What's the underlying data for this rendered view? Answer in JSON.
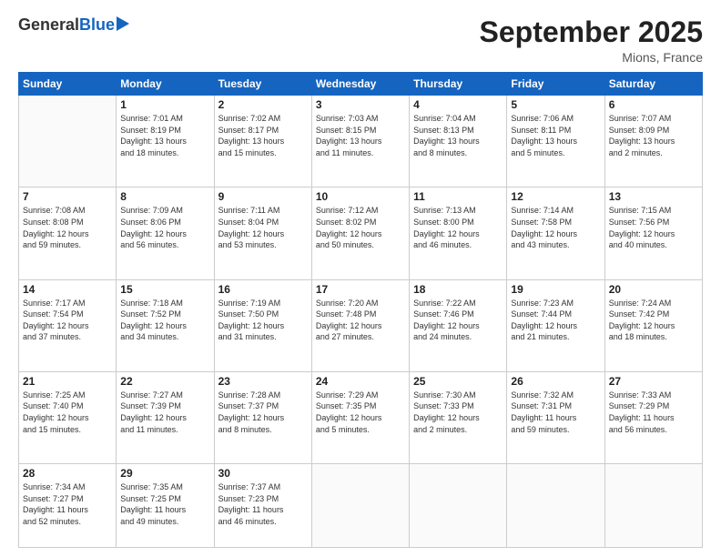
{
  "header": {
    "logo_general": "General",
    "logo_blue": "Blue",
    "month_title": "September 2025",
    "location": "Mions, France"
  },
  "days_of_week": [
    "Sunday",
    "Monday",
    "Tuesday",
    "Wednesday",
    "Thursday",
    "Friday",
    "Saturday"
  ],
  "weeks": [
    [
      {
        "day": "",
        "info": ""
      },
      {
        "day": "1",
        "info": "Sunrise: 7:01 AM\nSunset: 8:19 PM\nDaylight: 13 hours\nand 18 minutes."
      },
      {
        "day": "2",
        "info": "Sunrise: 7:02 AM\nSunset: 8:17 PM\nDaylight: 13 hours\nand 15 minutes."
      },
      {
        "day": "3",
        "info": "Sunrise: 7:03 AM\nSunset: 8:15 PM\nDaylight: 13 hours\nand 11 minutes."
      },
      {
        "day": "4",
        "info": "Sunrise: 7:04 AM\nSunset: 8:13 PM\nDaylight: 13 hours\nand 8 minutes."
      },
      {
        "day": "5",
        "info": "Sunrise: 7:06 AM\nSunset: 8:11 PM\nDaylight: 13 hours\nand 5 minutes."
      },
      {
        "day": "6",
        "info": "Sunrise: 7:07 AM\nSunset: 8:09 PM\nDaylight: 13 hours\nand 2 minutes."
      }
    ],
    [
      {
        "day": "7",
        "info": "Sunrise: 7:08 AM\nSunset: 8:08 PM\nDaylight: 12 hours\nand 59 minutes."
      },
      {
        "day": "8",
        "info": "Sunrise: 7:09 AM\nSunset: 8:06 PM\nDaylight: 12 hours\nand 56 minutes."
      },
      {
        "day": "9",
        "info": "Sunrise: 7:11 AM\nSunset: 8:04 PM\nDaylight: 12 hours\nand 53 minutes."
      },
      {
        "day": "10",
        "info": "Sunrise: 7:12 AM\nSunset: 8:02 PM\nDaylight: 12 hours\nand 50 minutes."
      },
      {
        "day": "11",
        "info": "Sunrise: 7:13 AM\nSunset: 8:00 PM\nDaylight: 12 hours\nand 46 minutes."
      },
      {
        "day": "12",
        "info": "Sunrise: 7:14 AM\nSunset: 7:58 PM\nDaylight: 12 hours\nand 43 minutes."
      },
      {
        "day": "13",
        "info": "Sunrise: 7:15 AM\nSunset: 7:56 PM\nDaylight: 12 hours\nand 40 minutes."
      }
    ],
    [
      {
        "day": "14",
        "info": "Sunrise: 7:17 AM\nSunset: 7:54 PM\nDaylight: 12 hours\nand 37 minutes."
      },
      {
        "day": "15",
        "info": "Sunrise: 7:18 AM\nSunset: 7:52 PM\nDaylight: 12 hours\nand 34 minutes."
      },
      {
        "day": "16",
        "info": "Sunrise: 7:19 AM\nSunset: 7:50 PM\nDaylight: 12 hours\nand 31 minutes."
      },
      {
        "day": "17",
        "info": "Sunrise: 7:20 AM\nSunset: 7:48 PM\nDaylight: 12 hours\nand 27 minutes."
      },
      {
        "day": "18",
        "info": "Sunrise: 7:22 AM\nSunset: 7:46 PM\nDaylight: 12 hours\nand 24 minutes."
      },
      {
        "day": "19",
        "info": "Sunrise: 7:23 AM\nSunset: 7:44 PM\nDaylight: 12 hours\nand 21 minutes."
      },
      {
        "day": "20",
        "info": "Sunrise: 7:24 AM\nSunset: 7:42 PM\nDaylight: 12 hours\nand 18 minutes."
      }
    ],
    [
      {
        "day": "21",
        "info": "Sunrise: 7:25 AM\nSunset: 7:40 PM\nDaylight: 12 hours\nand 15 minutes."
      },
      {
        "day": "22",
        "info": "Sunrise: 7:27 AM\nSunset: 7:39 PM\nDaylight: 12 hours\nand 11 minutes."
      },
      {
        "day": "23",
        "info": "Sunrise: 7:28 AM\nSunset: 7:37 PM\nDaylight: 12 hours\nand 8 minutes."
      },
      {
        "day": "24",
        "info": "Sunrise: 7:29 AM\nSunset: 7:35 PM\nDaylight: 12 hours\nand 5 minutes."
      },
      {
        "day": "25",
        "info": "Sunrise: 7:30 AM\nSunset: 7:33 PM\nDaylight: 12 hours\nand 2 minutes."
      },
      {
        "day": "26",
        "info": "Sunrise: 7:32 AM\nSunset: 7:31 PM\nDaylight: 11 hours\nand 59 minutes."
      },
      {
        "day": "27",
        "info": "Sunrise: 7:33 AM\nSunset: 7:29 PM\nDaylight: 11 hours\nand 56 minutes."
      }
    ],
    [
      {
        "day": "28",
        "info": "Sunrise: 7:34 AM\nSunset: 7:27 PM\nDaylight: 11 hours\nand 52 minutes."
      },
      {
        "day": "29",
        "info": "Sunrise: 7:35 AM\nSunset: 7:25 PM\nDaylight: 11 hours\nand 49 minutes."
      },
      {
        "day": "30",
        "info": "Sunrise: 7:37 AM\nSunset: 7:23 PM\nDaylight: 11 hours\nand 46 minutes."
      },
      {
        "day": "",
        "info": ""
      },
      {
        "day": "",
        "info": ""
      },
      {
        "day": "",
        "info": ""
      },
      {
        "day": "",
        "info": ""
      }
    ]
  ]
}
